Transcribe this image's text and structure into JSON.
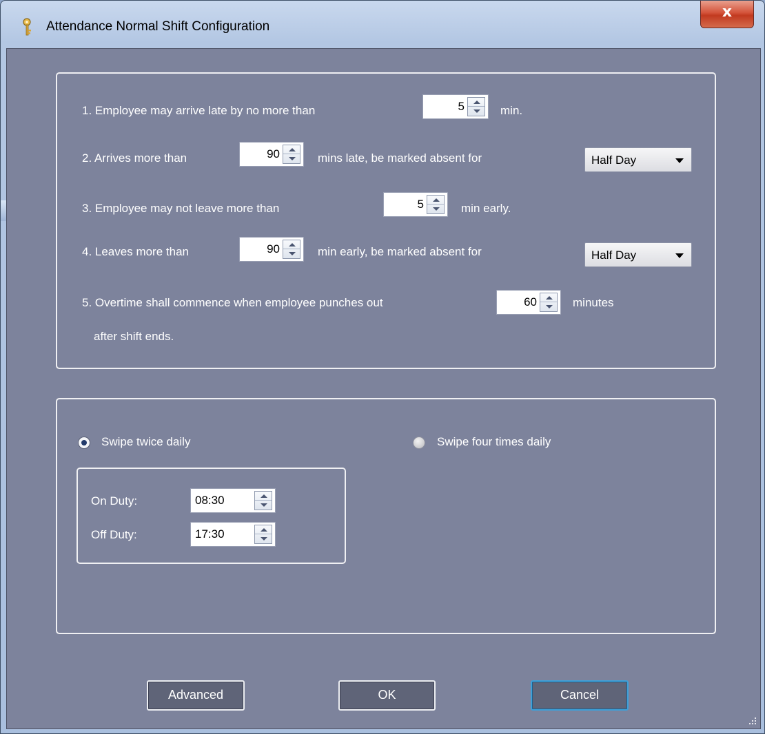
{
  "window": {
    "title": "Attendance Normal Shift Configuration",
    "close_label": "x"
  },
  "rules": {
    "r1": {
      "label": "1. Employee may arrive late by no more than",
      "value": "5",
      "unit": "min."
    },
    "r2": {
      "label": "2. Arrives more than",
      "value": "90",
      "suffix": "mins late, be marked absent for",
      "option": "Half Day"
    },
    "r3": {
      "label": "3. Employee may not leave more than",
      "value": "5",
      "unit": "min early."
    },
    "r4": {
      "label": "4. Leaves more than",
      "value": "90",
      "suffix": "min early, be marked absent for",
      "option": "Half Day"
    },
    "r5": {
      "label": "5. Overtime shall commence when employee punches out",
      "value": "60",
      "unit": "minutes",
      "line2": "after shift ends."
    }
  },
  "swipe": {
    "twice_label": "Swipe twice daily",
    "four_label": "Swipe four times daily",
    "selected": "twice",
    "on_duty_label": "On Duty:",
    "on_duty_value": "08:30",
    "off_duty_label": "Off Duty:",
    "off_duty_value": "17:30"
  },
  "buttons": {
    "advanced": "Advanced",
    "ok": "OK",
    "cancel": "Cancel"
  }
}
